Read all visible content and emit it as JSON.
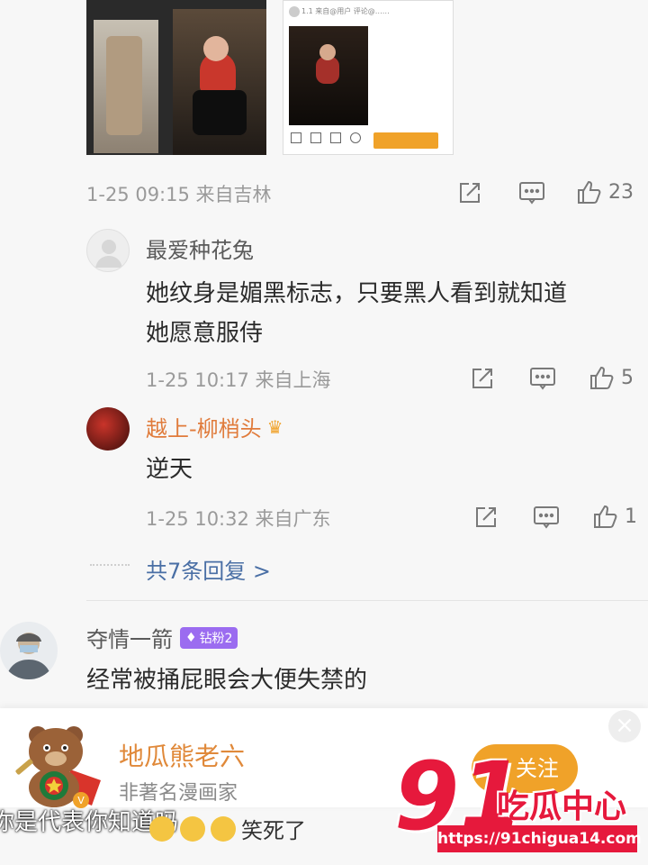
{
  "post": {
    "time": "1-25 09:15 来自吉林",
    "like_count": "23",
    "screenshot_caption": "1.1 来自@用户 评论@……"
  },
  "replies": [
    {
      "name": "最爱种花兔",
      "text": "她纹身是媚黑标志，只要黑人看到就知道她愿意服侍",
      "line1": "她纹身是媚黑标志，只要黑人看到就知道",
      "line2": "她愿意服侍",
      "time": "1-25 10:17 来自上海",
      "like_count": "5"
    },
    {
      "name": "越上-柳梢头",
      "text": "逆天",
      "time": "1-25 10:32 来自广东",
      "like_count": "1"
    }
  ],
  "more_replies": "共7条回复 >",
  "comment2": {
    "name": "夺情一箭",
    "badge": "钻粉2",
    "text": "经常被捅屁眼会大便失禁的",
    "emoji_text": "笑死了"
  },
  "overlay": {
    "name": "地瓜熊老六",
    "desc": "非著名漫画家",
    "follow_label": "+ 关注",
    "close": "×",
    "subtitle": "你是代表你知道吗"
  },
  "watermark": {
    "number": "91",
    "brand": "吃瓜中心",
    "url": "https://91chigua14.com"
  },
  "colors": {
    "orange": "#f0a229",
    "name_red": "#e07b3b",
    "badge_purple": "#9b6cf0",
    "watermark_red": "#e6193c"
  }
}
